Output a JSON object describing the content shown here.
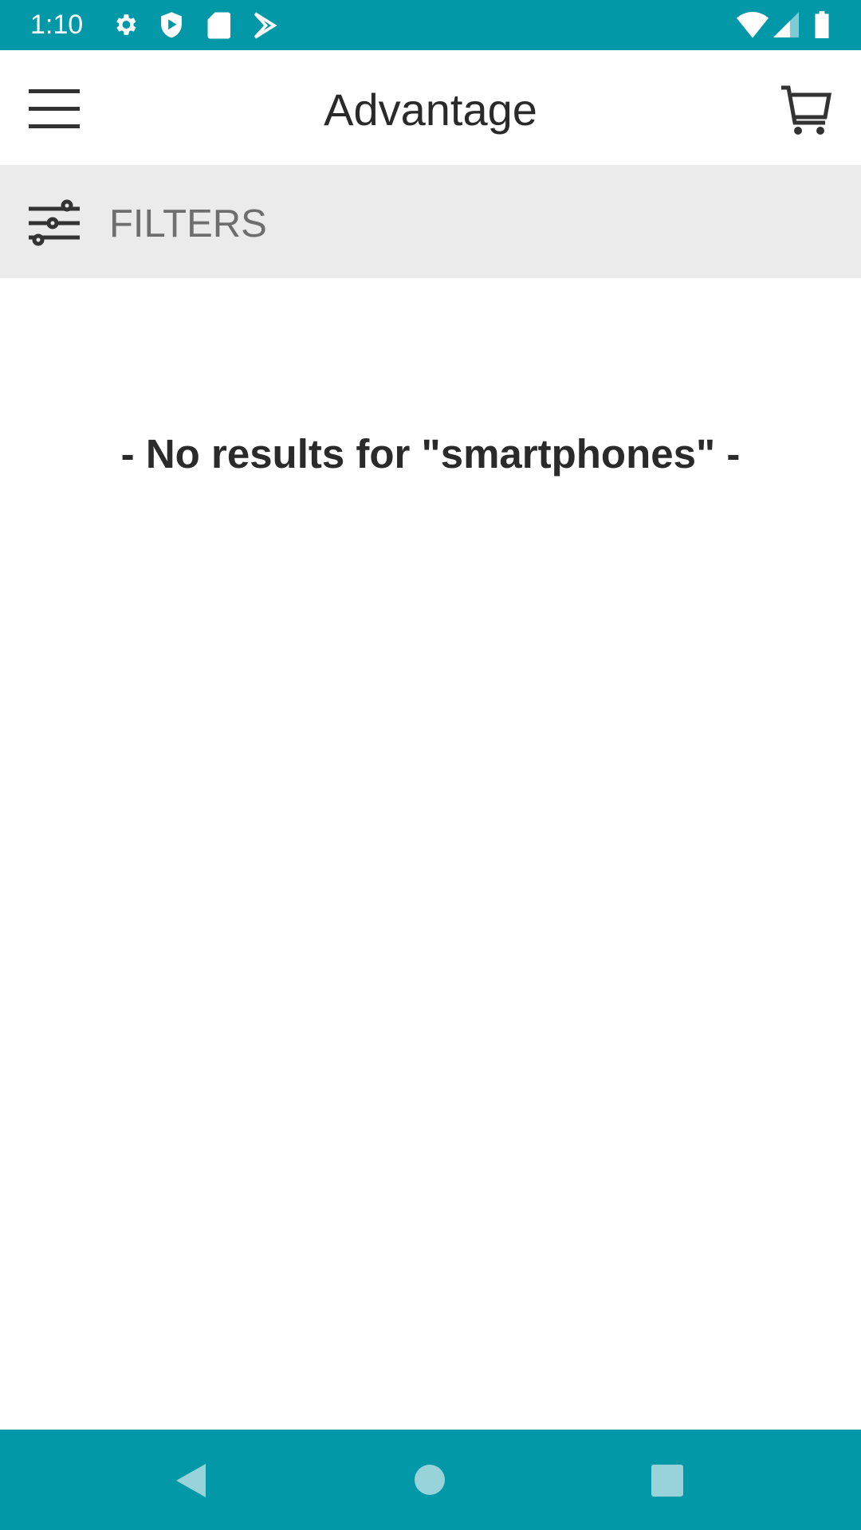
{
  "status_bar": {
    "time": "1:10",
    "icons": [
      "settings-icon",
      "shield-play-icon",
      "sd-card-icon",
      "play-store-icon",
      "wifi-icon",
      "signal-icon",
      "battery-icon"
    ],
    "color": "#0298a8"
  },
  "toolbar": {
    "title": "Advantage",
    "menu_icon": "hamburger-menu-icon",
    "cart_icon": "cart-icon"
  },
  "filters": {
    "label": "FILTERS",
    "icon": "sliders-icon"
  },
  "main": {
    "empty_message": "- No results for \"smartphones\" -"
  },
  "nav_bar": {
    "buttons": [
      "back",
      "home",
      "recents"
    ]
  }
}
